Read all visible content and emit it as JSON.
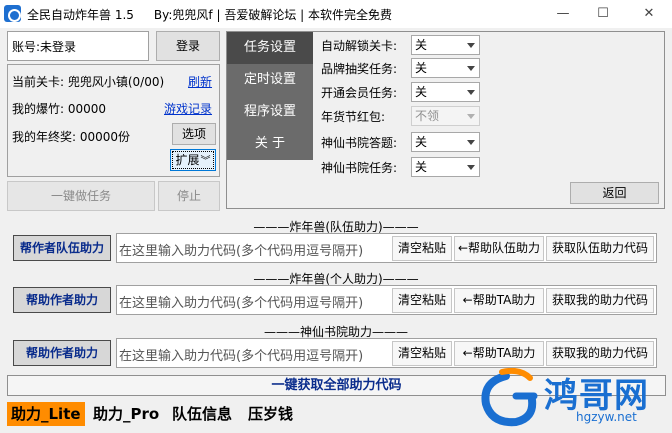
{
  "window": {
    "title": "全民自动炸年兽 1.5",
    "author": "By:兜兜风f",
    "forum": "吾爱破解论坛",
    "notice": "本软件完全免费",
    "minimize": "—",
    "maximize": "☐",
    "close": "✕"
  },
  "account": {
    "label": "账号:未登录",
    "login_button": "登录"
  },
  "stats": {
    "level": "当前关卡: 兜兜风小镇(0/00)",
    "refresh_link": "刷新",
    "firecracker": "我的爆竹: 00000",
    "game_log_link": "游戏记录",
    "bonus": "我的年终奖: 00000份",
    "options_button": "选项",
    "expand_button": "扩展",
    "expand_icon": "double-chevron-down-icon"
  },
  "actions": {
    "one_click_button": "一键做任务",
    "stop_button": "停止"
  },
  "settings": {
    "tabs": [
      "任务设置",
      "定时设置",
      "程序设置",
      "关 于"
    ],
    "active_tab": 0,
    "options": [
      {
        "label": "自动解锁关卡:",
        "value": "关",
        "enabled": true
      },
      {
        "label": "品牌抽奖任务:",
        "value": "关",
        "enabled": true
      },
      {
        "label": "开通会员任务:",
        "value": "关",
        "enabled": true
      },
      {
        "label": "年货节红包:",
        "value": "不领",
        "enabled": false
      },
      {
        "label": "神仙书院答题:",
        "value": "关",
        "enabled": true
      },
      {
        "label": "神仙书院任务:",
        "value": "关",
        "enabled": true
      }
    ],
    "back_button": "返回"
  },
  "help": {
    "placeholder": "在这里输入助力代码(多个代码用逗号隔开)",
    "clear_button": "清空粘贴",
    "sections": [
      {
        "title": "———炸年兽(队伍助力)———",
        "help_author": "帮作者队伍助力",
        "help_action": "←帮助队伍助力",
        "get_code": "获取队伍助力代码"
      },
      {
        "title": "———炸年兽(个人助力)———",
        "help_author": "帮助作者助力",
        "help_action": "←帮助TA助力",
        "get_code": "获取我的助力代码"
      },
      {
        "title": "———神仙书院助力———",
        "help_author": "帮助作者助力",
        "help_action": "←帮助TA助力",
        "get_code": "获取我的助力代码"
      }
    ],
    "get_all_button": "一键获取全部助力代码"
  },
  "bottom_tabs": [
    "助力_Lite",
    "助力_Pro",
    "队伍信息",
    "压岁钱"
  ],
  "active_bottom_tab": 0,
  "watermark": {
    "name": "鸿哥网",
    "url": "hgzyw.net"
  },
  "colors": {
    "accent_tab": "#ff8c00",
    "link": "#0033cc",
    "sidebar": "#6b6b6b",
    "help_button_text": "#0a2c8c",
    "watermark_blue": "#1a6fd1"
  }
}
